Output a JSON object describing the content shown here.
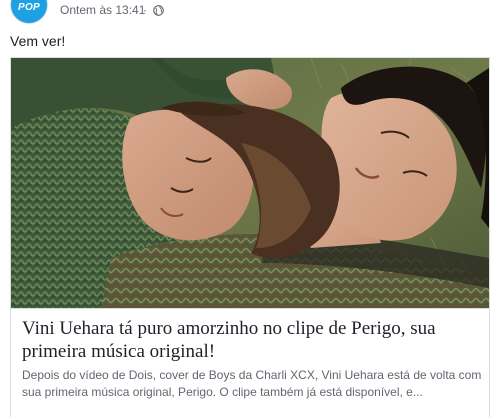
{
  "post": {
    "avatar_text": "POP",
    "timestamp": "Ontem às 13:41",
    "separator": "·",
    "privacy_icon": "globe-icon",
    "text": "Vem ver!"
  },
  "link_preview": {
    "image_description_icon": "photo",
    "title": "Vini Uehara tá puro amorzinho no clipe de Perigo, sua primeira música original!",
    "description": "Depois do vídeo de Dois, cover de Boys da Charli XCX, Vini Uehara está de volta com sua primeira música original, Perigo. O clipe também já está disponível, e..."
  },
  "colors": {
    "avatar_bg": "#1da1e3",
    "meta_text": "#616770",
    "title_text": "#1d2129",
    "desc_text": "#606770",
    "border": "#dadde1"
  }
}
